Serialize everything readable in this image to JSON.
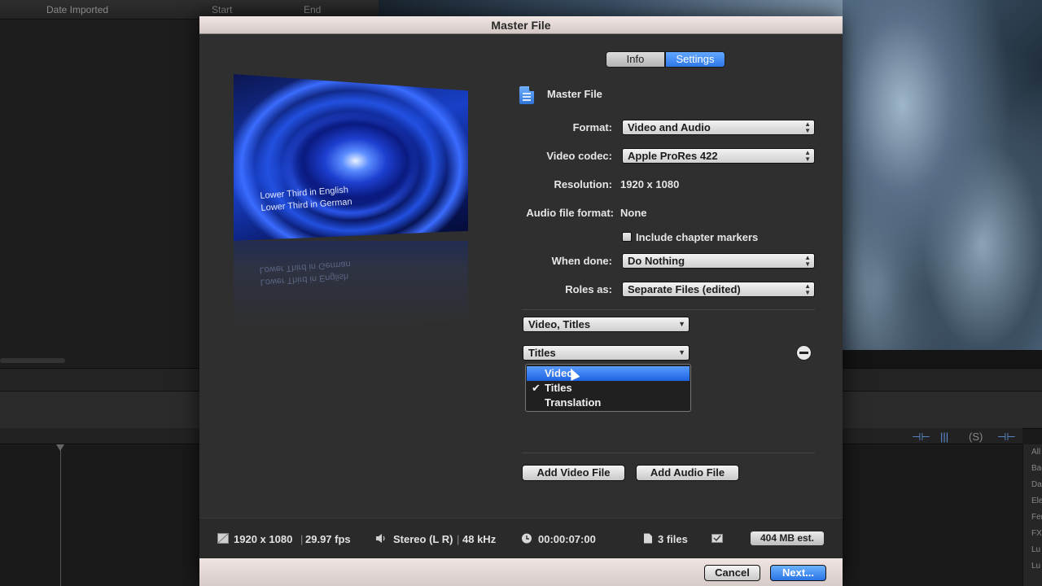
{
  "background": {
    "headers": [
      "Date Imported",
      "Start",
      "End"
    ],
    "sidebar_items": [
      "All",
      "Bac",
      "Dat",
      "Ele",
      "Fer",
      "FX",
      "Lu",
      "Lu"
    ]
  },
  "dialog": {
    "title": "Master File",
    "tabs": [
      {
        "label": "Info",
        "active": false
      },
      {
        "label": "Settings",
        "active": true
      }
    ],
    "preview": {
      "text_line1": "Lower Third in English",
      "text_line2": "Lower Third in German"
    },
    "heading": "Master File",
    "fields": {
      "format_label": "Format:",
      "format_value": "Video and Audio",
      "codec_label": "Video codec:",
      "codec_value": "Apple ProRes 422",
      "resolution_label": "Resolution:",
      "resolution_value": "1920 x 1080",
      "audio_format_label": "Audio file format:",
      "audio_format_value": "None",
      "chapter_markers_label": "Include chapter markers",
      "chapter_markers_checked": false,
      "when_done_label": "When done:",
      "when_done_value": "Do Nothing",
      "roles_label": "Roles as:",
      "roles_value": "Separate Files (edited)"
    },
    "role_files": [
      {
        "value": "Video, Titles"
      },
      {
        "value": "Titles"
      }
    ],
    "role_menu": {
      "items": [
        {
          "label": "Video",
          "checked": false,
          "highlighted": true
        },
        {
          "label": "Titles",
          "checked": true,
          "highlighted": false
        },
        {
          "label": "Translation",
          "checked": false,
          "highlighted": false
        }
      ],
      "check_glyph": "✔"
    },
    "buttons": {
      "add_video": "Add Video File",
      "add_audio": "Add Audio File",
      "cancel": "Cancel",
      "next": "Next..."
    },
    "status": {
      "resolution": "1920 x 1080",
      "sep": "|",
      "fps": "29.97 fps",
      "audio": "Stereo (L R)",
      "sample_rate": "48 kHz",
      "duration": "00:00:07:00",
      "files": "3 files",
      "estimate": "404 MB est."
    }
  },
  "colors": {
    "accent_blue": "#2e78e8",
    "dialog_bg": "#2f2f2f",
    "titlebar": "#e6dad8"
  }
}
